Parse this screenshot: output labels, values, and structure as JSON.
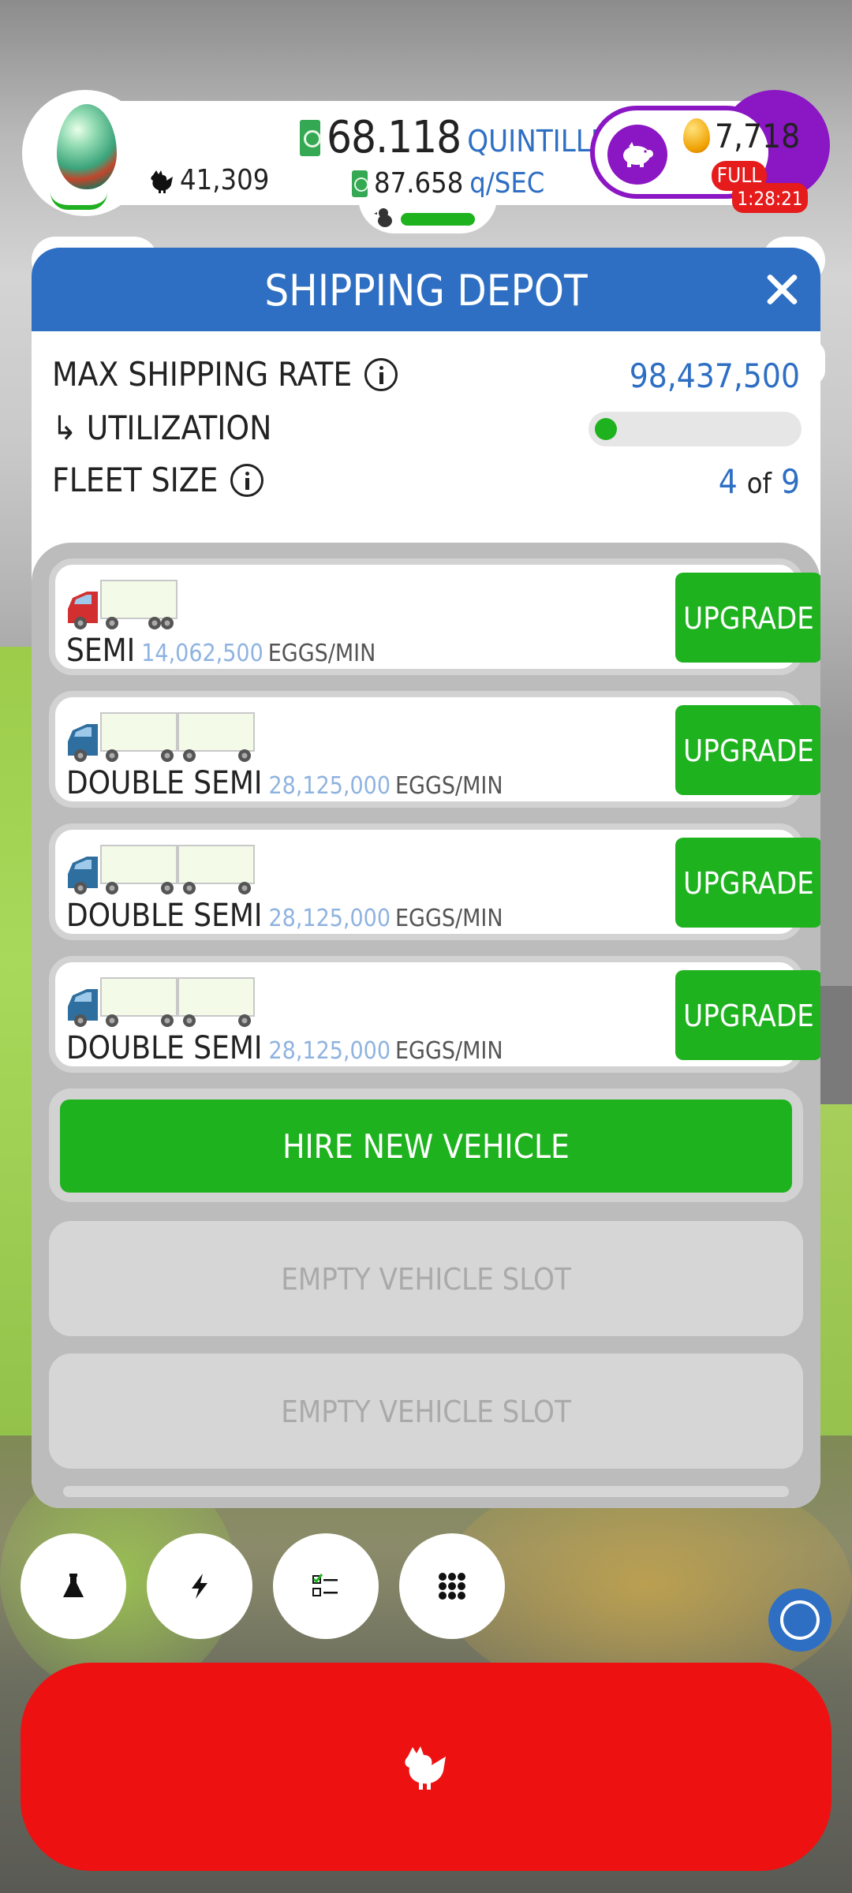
{
  "hud": {
    "chicken_count": "41,309",
    "cash_amount": "68.118",
    "cash_unit": "QUINTILLION",
    "rate_amount": "87.658",
    "rate_unit": "q/SEC",
    "golden_eggs": "7,718",
    "silo_status": "FULL",
    "event_timer": "1:28:21"
  },
  "modal": {
    "title": "SHIPPING DEPOT",
    "max_shipping_rate_label": "MAX SHIPPING RATE",
    "max_shipping_rate_value": "98,437,500",
    "utilization_label": "↳ UTILIZATION",
    "utilization_fraction": 0.06,
    "fleet_size_label": "FLEET SIZE",
    "fleet_size_current": "4",
    "fleet_size_of": "of",
    "fleet_size_max": "9"
  },
  "vehicles": [
    {
      "name": "SEMI",
      "rate": "14,062,500",
      "unit": "EGGS/MIN",
      "button": "UPGRADE",
      "trailers": 1,
      "cab_color": "#d23030"
    },
    {
      "name": "DOUBLE SEMI",
      "rate": "28,125,000",
      "unit": "EGGS/MIN",
      "button": "UPGRADE",
      "trailers": 2,
      "cab_color": "#2f6f9f"
    },
    {
      "name": "DOUBLE SEMI",
      "rate": "28,125,000",
      "unit": "EGGS/MIN",
      "button": "UPGRADE",
      "trailers": 2,
      "cab_color": "#2f6f9f"
    },
    {
      "name": "DOUBLE SEMI",
      "rate": "28,125,000",
      "unit": "EGGS/MIN",
      "button": "UPGRADE",
      "trailers": 2,
      "cab_color": "#2f6f9f"
    }
  ],
  "hire_button": "HIRE NEW VEHICLE",
  "empty_slots": [
    "EMPTY VEHICLE SLOT",
    "EMPTY VEHICLE SLOT"
  ],
  "bottom_bar": {
    "buttons": [
      "research-flask-icon",
      "boost-lightning-icon",
      "missions-checklist-icon",
      "menu-grid-icon"
    ]
  },
  "colors": {
    "accent_blue": "#2e6fc4",
    "action_green": "#1fb21f",
    "hatch_red": "#ee1111",
    "piggy_purple": "#8a16c4"
  }
}
